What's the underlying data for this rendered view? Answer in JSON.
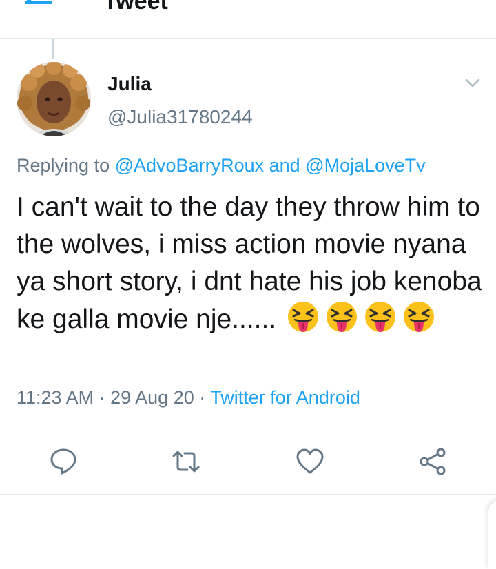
{
  "header": {
    "title": "Tweet",
    "back_icon": "back-arrow-icon"
  },
  "tweet": {
    "author": {
      "name": "Julia",
      "handle": "@Julia31780244"
    },
    "replying": {
      "prefix": "Replying to",
      "user1": "@AdvoBarryRoux",
      "conjunction": "and",
      "user2": "@MojaLoveTv"
    },
    "text": "I can't wait to the day they throw him to the wolves, i miss action movie nyana ya short story, i dnt hate his job kenoba ke galla movie nje......",
    "emoji_count": 4,
    "emoji_name": "squinting-face-with-tongue",
    "meta": {
      "time": "11:23 AM",
      "separator": "·",
      "date": "29 Aug 20",
      "source": "Twitter for Android"
    }
  },
  "actions": [
    "reply-icon",
    "retweet-icon",
    "like-icon",
    "share-icon"
  ],
  "colors": {
    "link": "#1da1f2",
    "muted": "#657786",
    "text": "#14171a",
    "divider": "#e1e8ed"
  }
}
